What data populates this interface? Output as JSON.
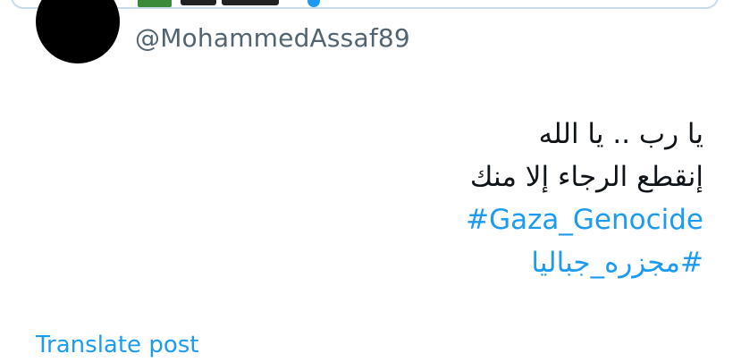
{
  "author": {
    "handle": "@MohammedAssaf89"
  },
  "tweet": {
    "lines": [
      "يا رب .. يا الله",
      "إنقطع الرجاء إلا منك"
    ],
    "hashtags": [
      "#Gaza_Genocide",
      "#مجزره_جباليا"
    ]
  },
  "actions": {
    "translate_label": "Translate post"
  },
  "colors": {
    "link": "#1d9bf0",
    "text": "#0f1419",
    "secondary": "#536471"
  }
}
